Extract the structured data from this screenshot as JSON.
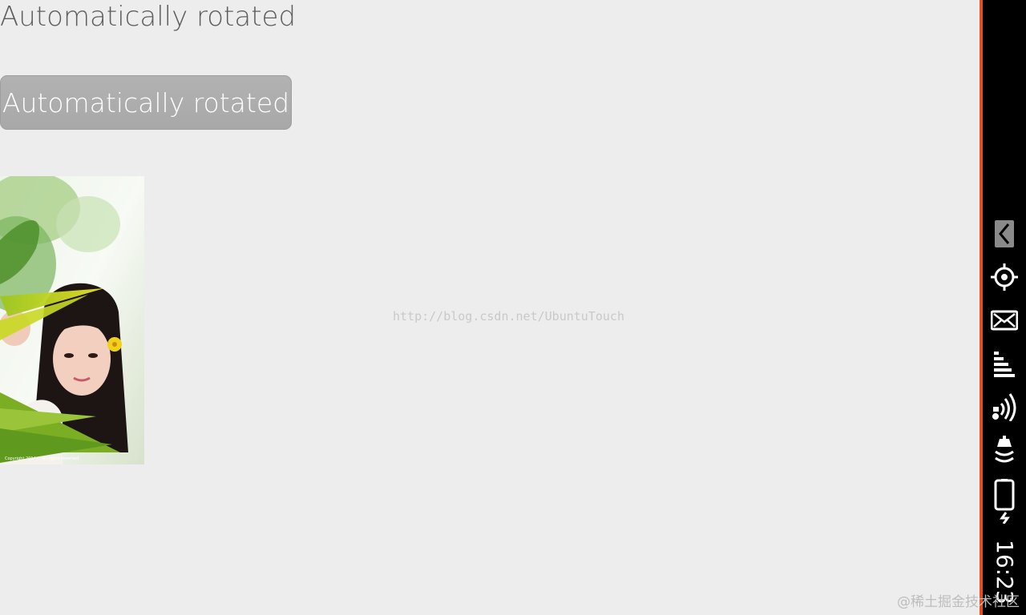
{
  "page": {
    "title": "Automatically rotated",
    "button_label": "Automatically rotated",
    "photo_caption": "Copyright 2014 ... All rights reserved"
  },
  "watermarks": {
    "center": "http://blog.csdn.net/UbuntuTouch",
    "corner": "@稀土掘金技术社区"
  },
  "indicators": {
    "icons": [
      "back-chevron-icon",
      "location-icon",
      "messages-icon",
      "sound-level-icon",
      "network-icon",
      "bluetooth-icon",
      "battery-charging-icon"
    ],
    "clock": "16:23"
  },
  "colors": {
    "background": "#ededed",
    "button": "#acacac",
    "indicator_bar": "#000000",
    "accent_edge": "#e1501c"
  }
}
